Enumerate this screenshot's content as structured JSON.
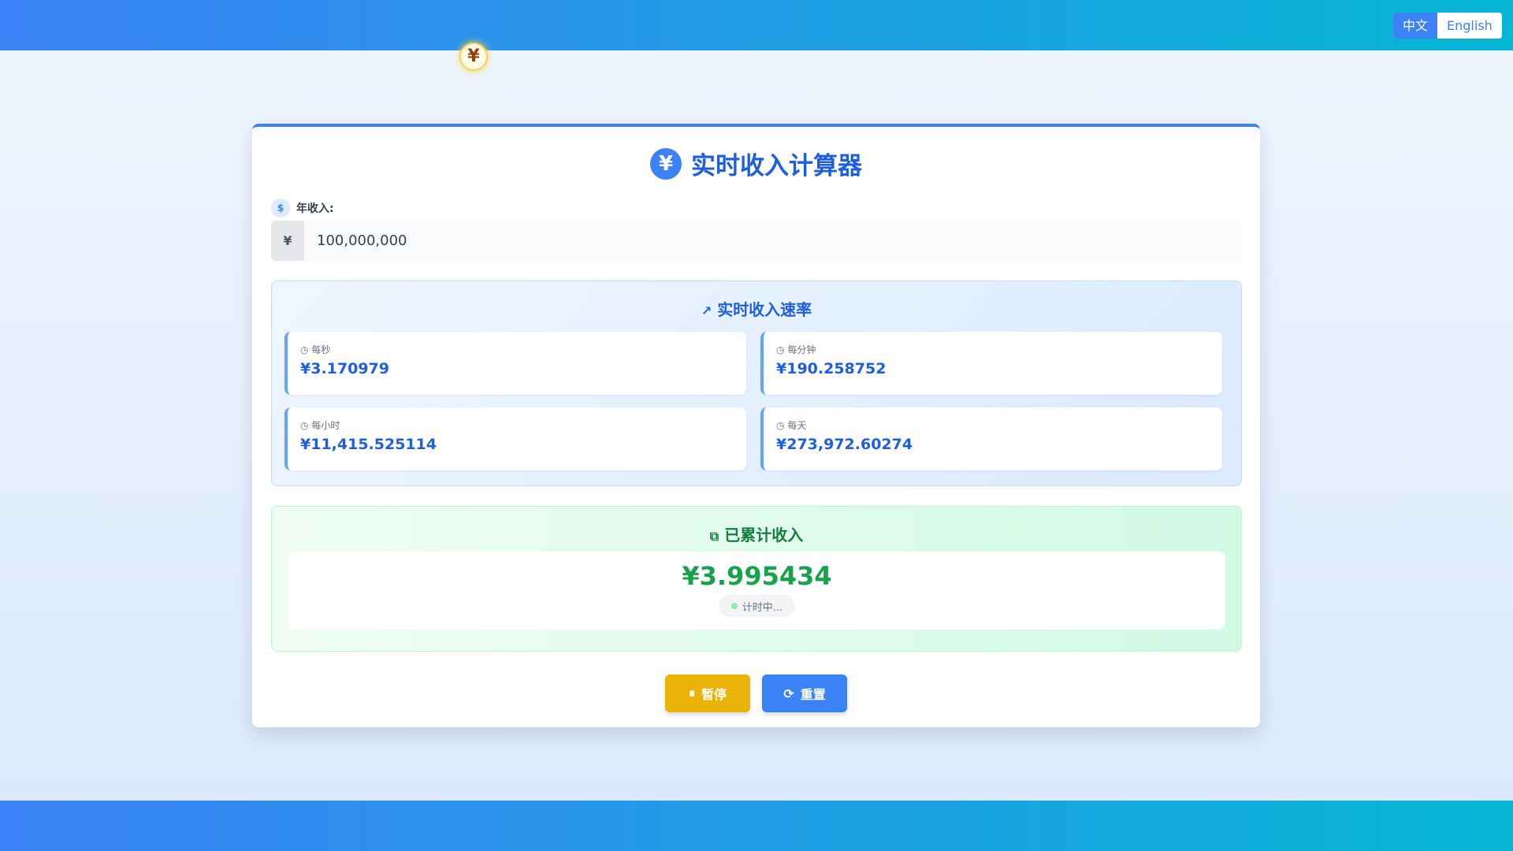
{
  "lang": {
    "zh": "中文",
    "en": "English"
  },
  "coin": "¥",
  "title": {
    "icon": "¥",
    "text": "实时收入计算器"
  },
  "income": {
    "label": "年收入:",
    "prefix": "¥",
    "value": "100,000,000"
  },
  "rates": {
    "title": "实时收入速率",
    "items": [
      {
        "label": "每秒",
        "value": "¥3.170979"
      },
      {
        "label": "每分钟",
        "value": "¥190.258752"
      },
      {
        "label": "每小时",
        "value": "¥11,415.525114"
      },
      {
        "label": "每天",
        "value": "¥273,972.60274"
      }
    ]
  },
  "accumulated": {
    "title": "已累计收入",
    "value": "¥3.995434",
    "status": "计时中..."
  },
  "buttons": {
    "pause": "暂停",
    "reset": "重置"
  }
}
